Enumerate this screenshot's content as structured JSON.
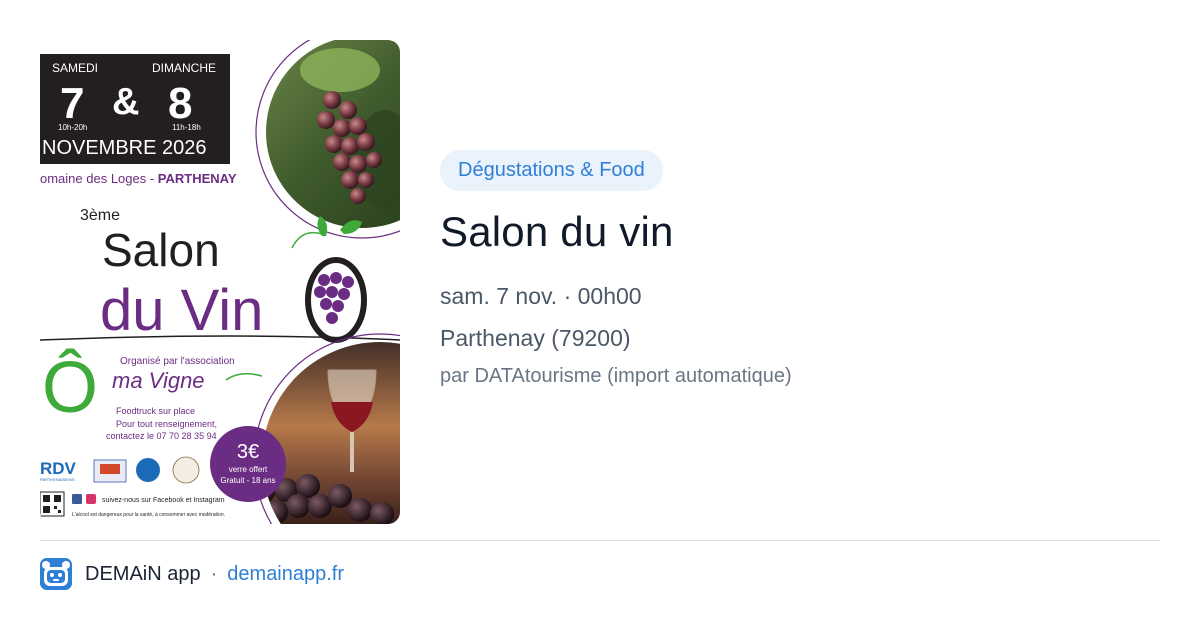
{
  "poster": {
    "day1": "SAMEDI",
    "day2": "DIMANCHE",
    "num1": "7",
    "amp": "&",
    "num2": "8",
    "hours1": "10h-20h",
    "hours2": "11h-18h",
    "month_year": "NOVEMBRE 2026",
    "venue_prefix": "omaine des Loges - ",
    "venue_city": "PARTHENAY",
    "edition": "3ème",
    "salon": "Salon",
    "du_vin": "du Vin",
    "organised_by": "Organisé par l'association",
    "assoc_o": "Ô",
    "assoc_name": "ma Vigne",
    "foodtruck": "Foodtruck sur place",
    "info1": "Pour tout renseignement,",
    "info2": "contactez le 07 70 28 35 94",
    "price": "3€",
    "price_line1": "verre offert",
    "price_line2": "Gratuit - 18 ans",
    "logo_rdv": "RDV",
    "logo_rdv_sub": "PARTHENAISIENS",
    "social": "suivez-nous sur Facebook et Instagram",
    "warning": "L'alcool est dangereux pour la santé, à consommer avec modération."
  },
  "event": {
    "category": "Dégustations & Food",
    "title": "Salon du vin",
    "date": "sam. 7 nov. · 00h00",
    "location": "Parthenay (79200)",
    "author": "par DATAtourisme (import automatique)"
  },
  "footer": {
    "app_name": "DEMAiN app",
    "separator": "·",
    "domain": "demainapp.fr"
  },
  "colors": {
    "accent": "#2f7fd6",
    "category_bg": "#eaf2fc",
    "poster_purple": "#6b2d83",
    "poster_green": "#3daa3a",
    "poster_black": "#231f20"
  }
}
